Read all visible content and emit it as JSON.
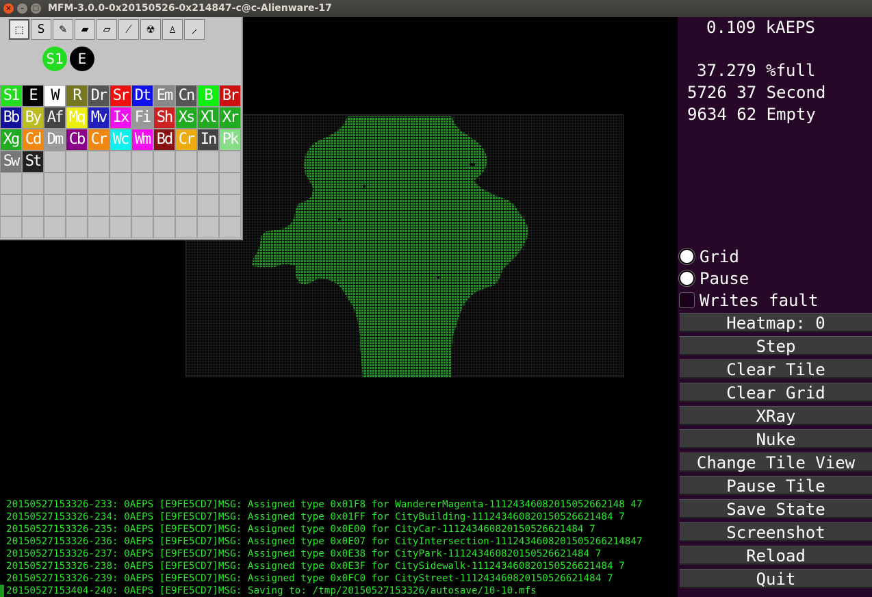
{
  "window": {
    "title": "MFM-3.0.0-0x20150526-0x214847-c@c-Alienware-17",
    "close_glyph": "×",
    "minimize_glyph": "–",
    "maximize_glyph": "□"
  },
  "colors": {
    "blob": "#2f8a2f",
    "panel_bg": "#280828",
    "log_text": "#29e829",
    "button_bg": "#3b3b3b"
  },
  "tools": [
    {
      "name": "selector-tool",
      "icon": "select-icon",
      "glyph": "⬚"
    },
    {
      "name": "atom-selector-tool",
      "icon": "atom-select-icon",
      "glyph": "S"
    },
    {
      "name": "pencil-tool",
      "icon": "pencil-icon",
      "glyph": "✎"
    },
    {
      "name": "bucket-tool",
      "icon": "bucket-icon",
      "glyph": "▰"
    },
    {
      "name": "eraser-tool",
      "icon": "eraser-icon",
      "glyph": "▱"
    },
    {
      "name": "brush-tool",
      "icon": "brush-icon",
      "glyph": "⁄"
    },
    {
      "name": "xray-tool",
      "icon": "radiation-icon",
      "glyph": "☢"
    },
    {
      "name": "airbrush-tool",
      "icon": "airbrush-icon",
      "glyph": "♙"
    },
    {
      "name": "clone-tool",
      "icon": "clone-icon",
      "glyph": "⸝"
    }
  ],
  "selected_elements": {
    "primary": {
      "label": "S1",
      "bg": "#22dd22",
      "fg": "#ffffff"
    },
    "secondary": {
      "label": "E",
      "bg": "#000000",
      "fg": "#ffffff"
    }
  },
  "elements": [
    {
      "label": "S1",
      "bg": "#22dd22",
      "fg": "#ffffff"
    },
    {
      "label": "E",
      "bg": "#000000",
      "fg": "#ffffff"
    },
    {
      "label": "W",
      "bg": "#ffffff",
      "fg": "#000000"
    },
    {
      "label": "R",
      "bg": "#777722",
      "fg": "#ffffff"
    },
    {
      "label": "Dr",
      "bg": "#555555",
      "fg": "#ffffff"
    },
    {
      "label": "Sr",
      "bg": "#ee1111",
      "fg": "#ffffff"
    },
    {
      "label": "Dt",
      "bg": "#1111ee",
      "fg": "#ffffff"
    },
    {
      "label": "Em",
      "bg": "#888888",
      "fg": "#ffffff"
    },
    {
      "label": "Cn",
      "bg": "#555555",
      "fg": "#ffffff"
    },
    {
      "label": "B",
      "bg": "#11ee11",
      "fg": "#ffffff"
    },
    {
      "label": "Br",
      "bg": "#cc1111",
      "fg": "#ffffff"
    },
    {
      "label": "Bb",
      "bg": "#111199",
      "fg": "#ffffff"
    },
    {
      "label": "By",
      "bg": "#bbbb22",
      "fg": "#ffffff"
    },
    {
      "label": "Af",
      "bg": "#444444",
      "fg": "#ffffff"
    },
    {
      "label": "Mq",
      "bg": "#eeee11",
      "fg": "#ffffff"
    },
    {
      "label": "Mv",
      "bg": "#2222bb",
      "fg": "#ffffff"
    },
    {
      "label": "Ix",
      "bg": "#ee11ee",
      "fg": "#ffffff"
    },
    {
      "label": "Fi",
      "bg": "#999999",
      "fg": "#ffffff"
    },
    {
      "label": "Sh",
      "bg": "#cc2222",
      "fg": "#ffffff"
    },
    {
      "label": "Xs",
      "bg": "#22aa22",
      "fg": "#ffffff"
    },
    {
      "label": "Xl",
      "bg": "#22aa22",
      "fg": "#ffffff"
    },
    {
      "label": "Xr",
      "bg": "#22aa22",
      "fg": "#ffffff"
    },
    {
      "label": "Xg",
      "bg": "#22aa22",
      "fg": "#ffffff"
    },
    {
      "label": "Cd",
      "bg": "#ee8811",
      "fg": "#ffffff"
    },
    {
      "label": "Dm",
      "bg": "#999999",
      "fg": "#ffffff"
    },
    {
      "label": "Cb",
      "bg": "#880088",
      "fg": "#ffffff"
    },
    {
      "label": "Cr",
      "bg": "#ee8811",
      "fg": "#ffffff"
    },
    {
      "label": "Wc",
      "bg": "#11eeee",
      "fg": "#ffffff"
    },
    {
      "label": "Wm",
      "bg": "#ee11ee",
      "fg": "#ffffff"
    },
    {
      "label": "Bd",
      "bg": "#881111",
      "fg": "#ffffff"
    },
    {
      "label": "Cr",
      "bg": "#eeaa11",
      "fg": "#ffffff"
    },
    {
      "label": "In",
      "bg": "#444444",
      "fg": "#ffffff"
    },
    {
      "label": "Pk",
      "bg": "#88dd88",
      "fg": "#ffffff"
    },
    {
      "label": "Sw",
      "bg": "#777777",
      "fg": "#ffffff"
    },
    {
      "label": "St",
      "bg": "#222222",
      "fg": "#ffffff"
    }
  ],
  "stats": {
    "aeps": "0.109 kAEPS",
    "full": "37.279 %full",
    "row2": "5726 37 Second",
    "row3": "9634 62 Empty"
  },
  "checkboxes": [
    {
      "label": "Grid",
      "checked": true
    },
    {
      "label": "Pause",
      "checked": true
    },
    {
      "label": "Writes fault",
      "checked": false
    }
  ],
  "buttons": [
    "Heatmap: 0",
    "Step",
    "Clear Tile",
    "Clear Grid",
    "XRay",
    "Nuke",
    "Change Tile View",
    "Pause Tile",
    "Save State",
    "Screenshot",
    "Reload",
    "Quit"
  ],
  "log": [
    "20150527153326-233: 0AEPS [E9FE5CD7]MSG: Assigned type 0x01F8 for WandererMagenta-11124346082015052662148 47",
    "20150527153326-234: 0AEPS [E9FE5CD7]MSG: Assigned type 0x01FF for CityBuilding-111243460820150526621484 7",
    "20150527153326-235: 0AEPS [E9FE5CD7]MSG: Assigned type 0x0E00 for CityCar-111243460820150526621484 7",
    "20150527153326-236: 0AEPS [E9FE5CD7]MSG: Assigned type 0x0E07 for CityIntersection-1112434608201505266214847",
    "20150527153326-237: 0AEPS [E9FE5CD7]MSG: Assigned type 0x0E38 for CityPark-111243460820150526621484 7",
    "20150527153326-238: 0AEPS [E9FE5CD7]MSG: Assigned type 0x0E3F for CitySidewalk-111243460820150526621484 7",
    "20150527153326-239: 0AEPS [E9FE5CD7]MSG: Assigned type 0x0FC0 for CityStreet-111243460820150526621484 7",
    "20150527153404-240: 0AEPS [E9FE5CD7]MSG: Saving to: /tmp/20150527153326/autosave/10-10.mfs"
  ]
}
